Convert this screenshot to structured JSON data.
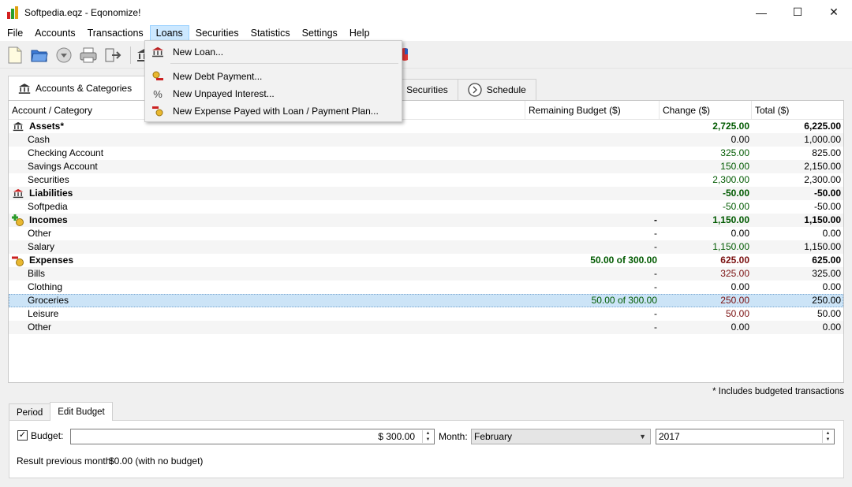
{
  "window": {
    "title": "Softpedia.eqz - Eqonomize!",
    "minimize": "—",
    "maximize": "☐",
    "close": "✕"
  },
  "menubar": [
    "File",
    "Accounts",
    "Transactions",
    "Loans",
    "Securities",
    "Statistics",
    "Settings",
    "Help"
  ],
  "loans_menu": {
    "items": [
      "New Loan...",
      "New Debt Payment...",
      "New Unpayed Interest...",
      "New Expense Payed with Loan / Payment Plan..."
    ]
  },
  "tabs": [
    "Accounts & Categories",
    "Securities",
    "Schedule"
  ],
  "table": {
    "headers": [
      "Account / Category",
      "Remaining Budget ($)",
      "Change ($)",
      "Total ($)"
    ],
    "rows": [
      {
        "name": "Assets*",
        "budget": "",
        "change": "2,725.00",
        "total": "6,225.00",
        "group": true,
        "icon": "bank-icon",
        "style": "pos"
      },
      {
        "name": "Cash",
        "budget": "",
        "change": "0.00",
        "total": "1,000.00",
        "style": "zero"
      },
      {
        "name": "Checking Account",
        "budget": "",
        "change": "325.00",
        "total": "825.00",
        "style": "pos"
      },
      {
        "name": "Savings Account",
        "budget": "",
        "change": "150.00",
        "total": "2,150.00",
        "style": "pos"
      },
      {
        "name": "Securities",
        "budget": "",
        "change": "2,300.00",
        "total": "2,300.00",
        "style": "pos"
      },
      {
        "name": "Liabilities",
        "budget": "",
        "change": "-50.00",
        "total": "-50.00",
        "group": true,
        "icon": "liability-icon",
        "style": "pos"
      },
      {
        "name": "Softpedia",
        "budget": "",
        "change": "-50.00",
        "total": "-50.00",
        "style": "pos"
      },
      {
        "name": "Incomes",
        "budget": "-",
        "change": "1,150.00",
        "total": "1,150.00",
        "group": true,
        "icon": "income-icon",
        "style": "pos"
      },
      {
        "name": "Other",
        "budget": "-",
        "change": "0.00",
        "total": "0.00",
        "style": "zero"
      },
      {
        "name": "Salary",
        "budget": "-",
        "change": "1,150.00",
        "total": "1,150.00",
        "style": "pos"
      },
      {
        "name": "Expenses",
        "budget": "50.00 of 300.00",
        "change": "625.00",
        "total": "625.00",
        "group": true,
        "icon": "expense-icon",
        "style": "neg",
        "budget_style": "pos"
      },
      {
        "name": "Bills",
        "budget": "-",
        "change": "325.00",
        "total": "325.00",
        "style": "neg"
      },
      {
        "name": "Clothing",
        "budget": "-",
        "change": "0.00",
        "total": "0.00",
        "style": "zero"
      },
      {
        "name": "Groceries",
        "budget": "50.00 of 300.00",
        "change": "250.00",
        "total": "250.00",
        "style": "neg",
        "budget_style": "pos",
        "selected": true
      },
      {
        "name": "Leisure",
        "budget": "-",
        "change": "50.00",
        "total": "50.00",
        "style": "neg"
      },
      {
        "name": "Other",
        "budget": "-",
        "change": "0.00",
        "total": "0.00",
        "style": "zero"
      }
    ]
  },
  "note": "* Includes budgeted transactions",
  "bottom_tabs": [
    "Period",
    "Edit Budget"
  ],
  "budget": {
    "checkbox_label": "Budget:",
    "checked": true,
    "value": "$ 300.00",
    "month_label": "Month:",
    "month": "February",
    "year": "2017",
    "result_label": "Result previous month:",
    "result_value": "$0.00 (with no budget)"
  },
  "colors": {
    "positive": "#005a00",
    "negative": "#7a1010",
    "selection": "#cce4f7",
    "menu_highlight": "#cce8ff"
  }
}
